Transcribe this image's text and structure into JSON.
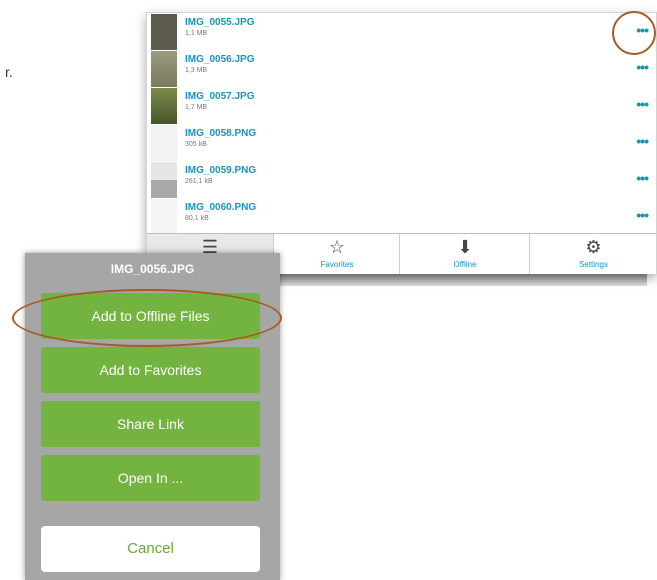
{
  "page": {
    "stray_text": "r."
  },
  "files": [
    {
      "name": "IMG_0055.JPG",
      "size": "1,1 MB",
      "thumb": "#5d5a4e",
      "more": "•••"
    },
    {
      "name": "IMG_0056.JPG",
      "size": "1,3 MB",
      "thumb": "#8b8a6f",
      "more": "•••"
    },
    {
      "name": "IMG_0057.JPG",
      "size": "1,7 MB",
      "thumb": "#5a6a38",
      "more": "•••"
    },
    {
      "name": "IMG_0058.PNG",
      "size": "305 kB",
      "thumb": "#f2f2f2",
      "more": "•••"
    },
    {
      "name": "IMG_0059.PNG",
      "size": "261,1 kB",
      "thumb": "#bdbdbd",
      "more": "•••"
    },
    {
      "name": "IMG_0060.PNG",
      "size": "80,1 kB",
      "thumb": "#f4f4f4",
      "more": "•••"
    }
  ],
  "tabs": [
    {
      "icon": "server-icon",
      "glyph": "☰",
      "label": ""
    },
    {
      "icon": "star-icon",
      "glyph": "☆",
      "label": "Favorites"
    },
    {
      "icon": "download-icon",
      "glyph": "⬇",
      "label": "Offline"
    },
    {
      "icon": "gear-icon",
      "glyph": "⚙",
      "label": "Settings"
    }
  ],
  "sheet": {
    "title": "IMG_0056.JPG",
    "actions": [
      {
        "label": "Add to Offline Files"
      },
      {
        "label": "Add to Favorites"
      },
      {
        "label": "Share Link"
      },
      {
        "label": "Open In ..."
      }
    ],
    "cancel": "Cancel"
  },
  "colors": {
    "accent": "#1a93b9",
    "action_green": "#72b43f",
    "highlight_ring": "#a55b21"
  }
}
